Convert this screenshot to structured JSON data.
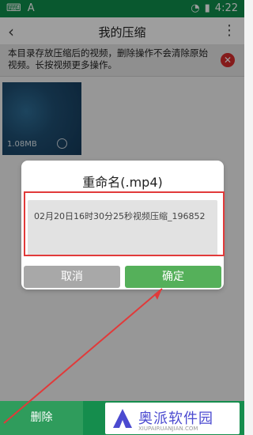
{
  "status": {
    "time": "4:22"
  },
  "appbar": {
    "title": "我的压缩"
  },
  "notice": {
    "text": "本目录存放压缩后的视频，删除操作不会清除原始视频。长按视频更多操作。"
  },
  "video": {
    "size": "1.08MB"
  },
  "dialog": {
    "title": "重命名(.mp4)",
    "input_value": "02月20日16时30分25秒视频压缩_196852",
    "cancel_label": "取消",
    "ok_label": "确定"
  },
  "bottom": {
    "delete_label": "删除"
  },
  "watermark": {
    "brand": "奥派软件园",
    "url": "XIUPAIRUANJIAN.COM"
  }
}
